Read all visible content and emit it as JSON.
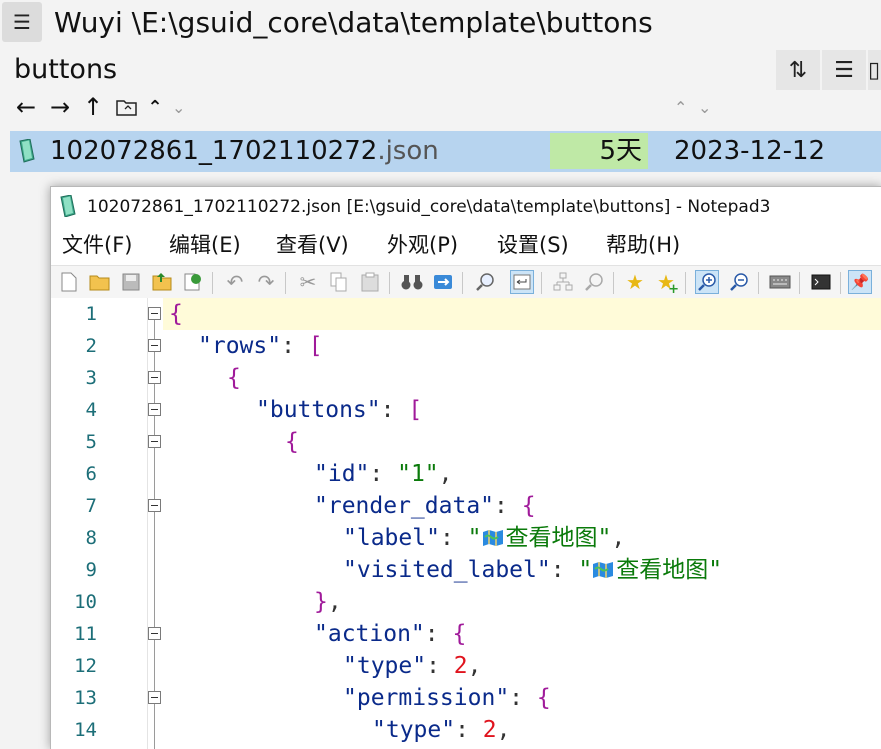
{
  "file_manager": {
    "path": "Wuyi \\E:\\gsuid_core\\data\\template\\buttons",
    "folder_title": "buttons",
    "file": {
      "name": "102072861_1702110272",
      "ext": ".json",
      "age": "5天",
      "date": "2023-12-12"
    }
  },
  "notepad": {
    "title": "102072861_1702110272.json [E:\\gsuid_core\\data\\template\\buttons] - Notepad3",
    "menu": [
      "文件(F)",
      "编辑(E)",
      "查看(V)",
      "外观(P)",
      "设置(S)",
      "帮助(H)"
    ],
    "line_numbers": [
      "1",
      "2",
      "3",
      "4",
      "5",
      "6",
      "7",
      "8",
      "9",
      "10",
      "11",
      "12",
      "13",
      "14"
    ],
    "code": {
      "l1_brace": "{",
      "rows_key": "\"rows\"",
      "l2_sep": ": ",
      "l2_bracket": "[",
      "l3_brace": "{",
      "buttons_key": "\"buttons\"",
      "l4_sep": ": ",
      "l4_bracket": "[",
      "l5_brace": "{",
      "id_key": "\"id\"",
      "l6_sep": ": ",
      "id_val": "\"1\"",
      "l6_comma": ",",
      "render_key": "\"render_data\"",
      "l7_sep": ": ",
      "l7_brace": "{",
      "label_key": "\"label\"",
      "l8_sep": ": ",
      "label_q": "\"",
      "label_val": "查看地图\"",
      "l8_comma": ",",
      "visited_key": "\"visited_label\"",
      "l9_sep": ": ",
      "visited_q": "\"",
      "visited_val": "查看地图\"",
      "l10_brace": "}",
      "l10_comma": ",",
      "action_key": "\"action\"",
      "l11_sep": ": ",
      "l11_brace": "{",
      "type_key": "\"type\"",
      "l12_sep": ": ",
      "type_val": "2",
      "l12_comma": ",",
      "perm_key": "\"permission\"",
      "l13_sep": ": ",
      "l13_brace": "{",
      "type2_key": "\"type\"",
      "l14_sep": ": ",
      "type2_val": "2",
      "l14_comma": ","
    },
    "colors": {
      "key": "#0a2a8a",
      "string": "#0a7a0a",
      "number": "#e0141e",
      "brace": "#a01a9a",
      "line_number": "#1c6e78",
      "current_line": "#fffbd9"
    }
  }
}
